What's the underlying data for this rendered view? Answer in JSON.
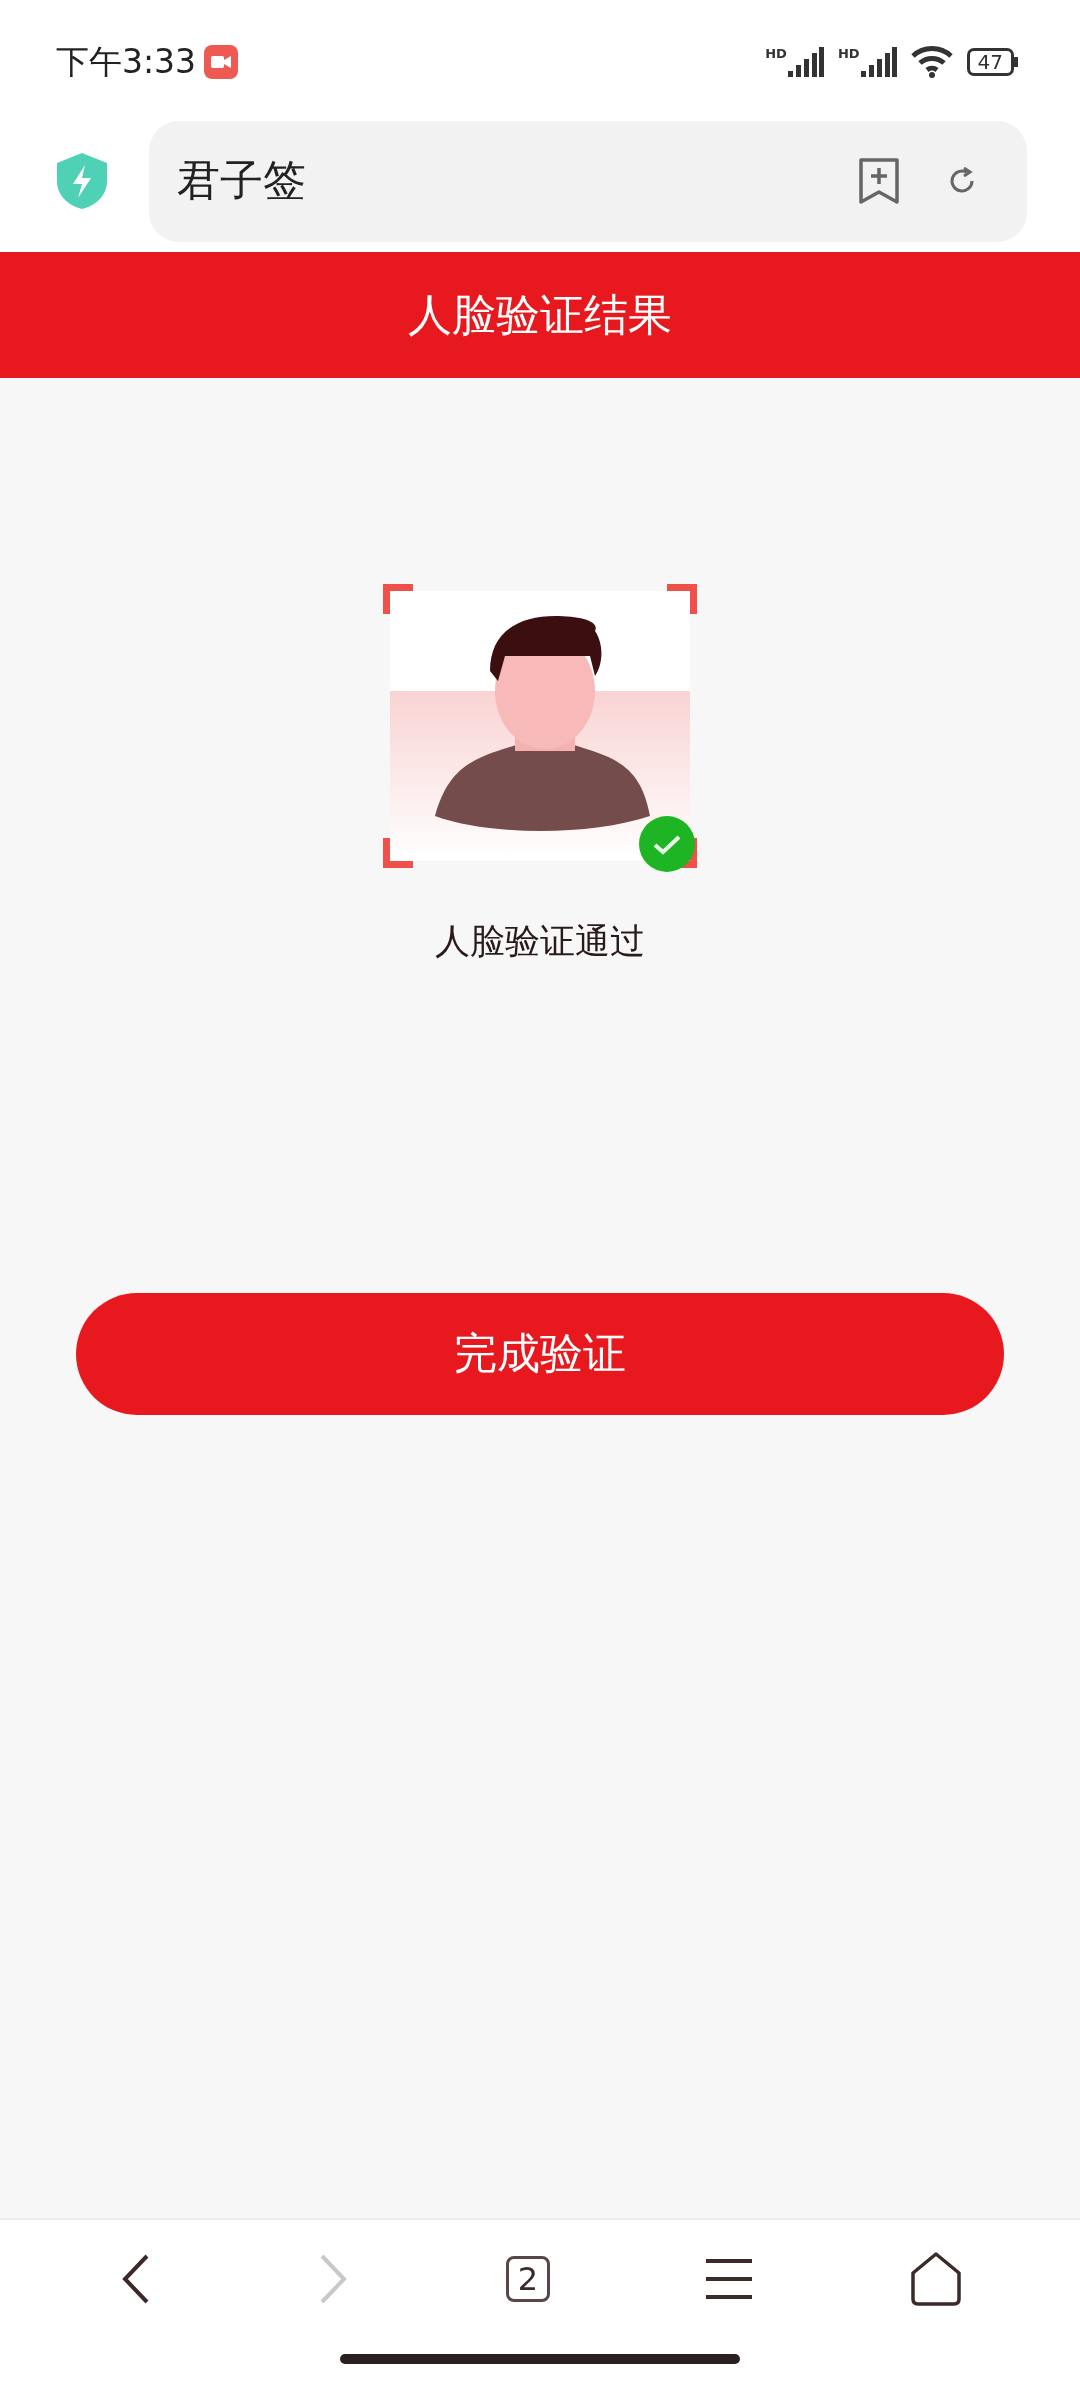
{
  "status_bar": {
    "time": "下午3:33",
    "signals": [
      {
        "label": "HD"
      },
      {
        "label": "HD"
      }
    ],
    "battery": "47"
  },
  "address_bar": {
    "title": "君子签"
  },
  "header": {
    "title": "人脸验证结果"
  },
  "result": {
    "verified": true,
    "message": "人脸验证通过"
  },
  "primary_button": {
    "label": "完成验证"
  },
  "bottom_nav": {
    "back_disabled": false,
    "forward_disabled": true,
    "tab_count": "2"
  }
}
